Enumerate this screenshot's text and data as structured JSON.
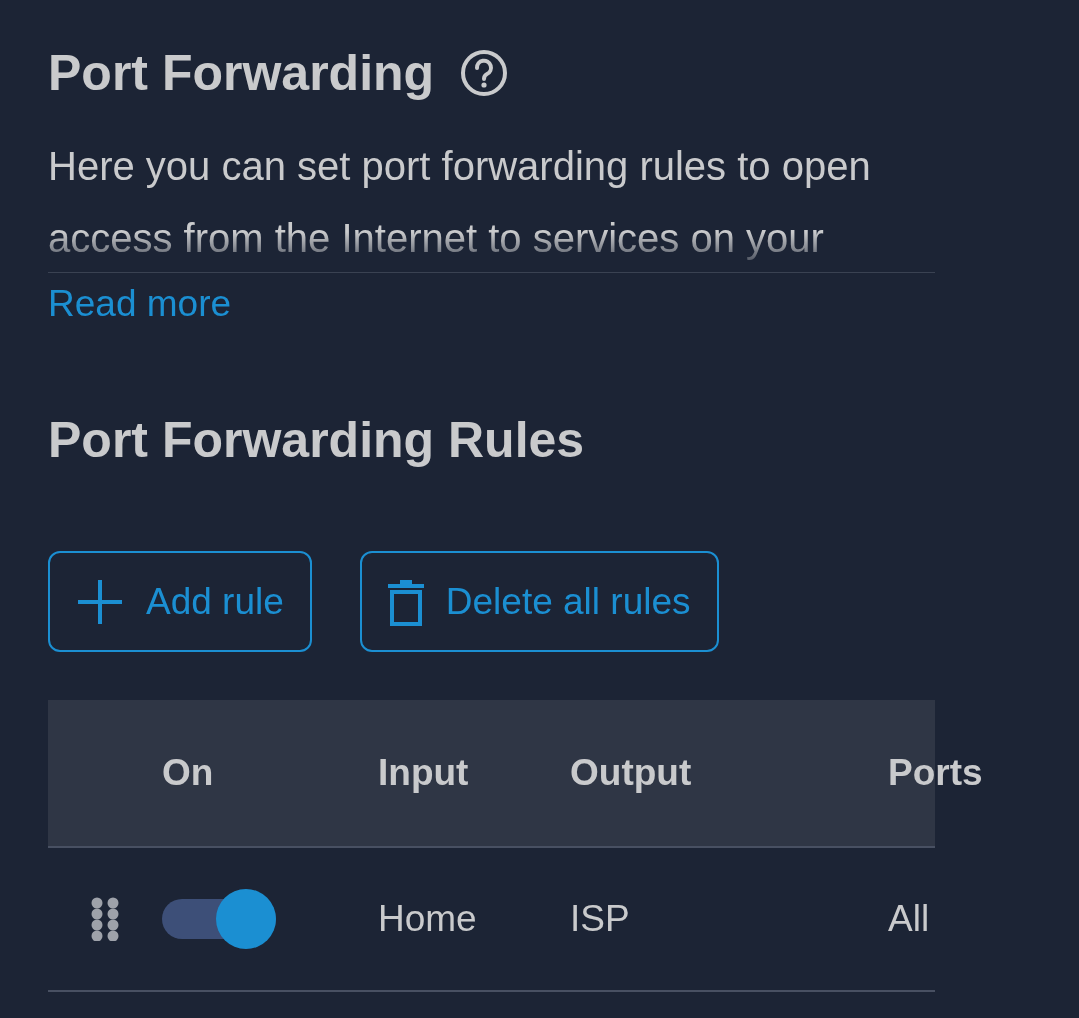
{
  "header": {
    "title": "Port Forwarding",
    "description": "Here you can set port forwarding rules to open access from the Internet to services on your",
    "read_more": "Read more"
  },
  "rules_section": {
    "title": "Port Forwarding Rules",
    "buttons": [
      {
        "kind": "add",
        "label": "Add rule"
      },
      {
        "kind": "delete",
        "label": "Delete all rules"
      }
    ]
  },
  "table": {
    "columns": [
      "On",
      "Input",
      "Output",
      "Ports"
    ],
    "rows": [
      {
        "on": true,
        "input": "Home",
        "output": "ISP",
        "ports": "All"
      }
    ]
  }
}
